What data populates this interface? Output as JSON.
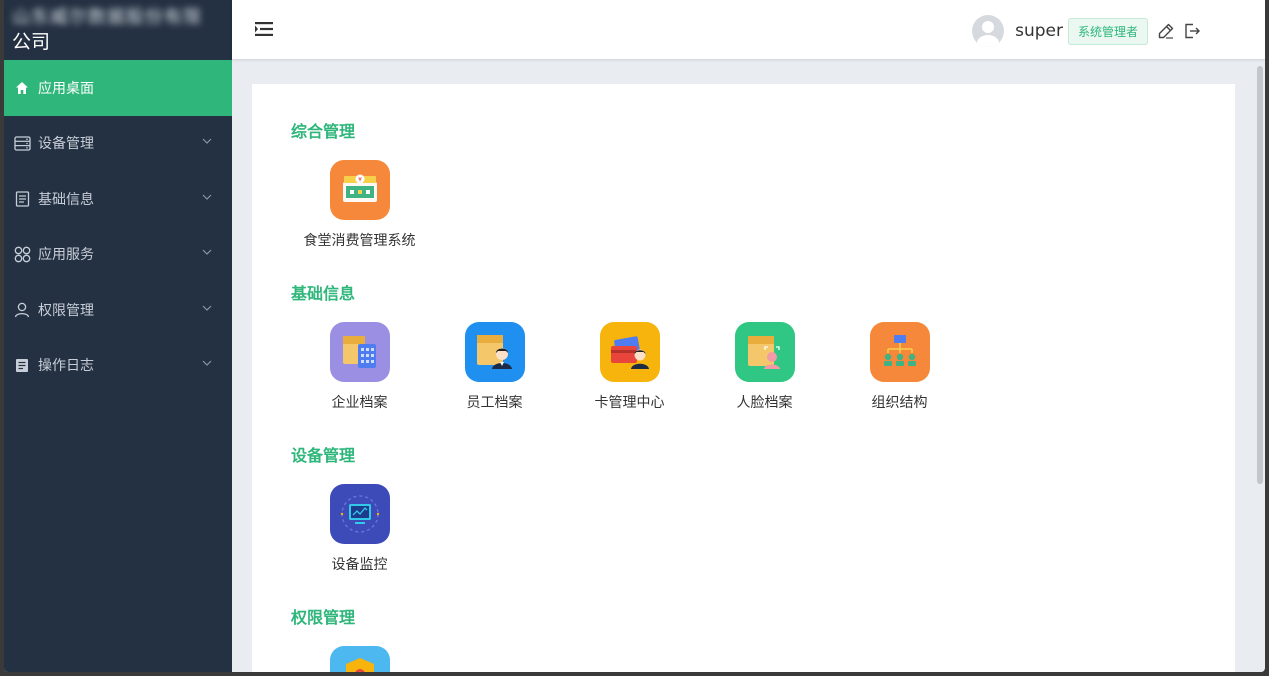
{
  "sidebar": {
    "brand_line1": "山东威尔数据股份有限",
    "brand_line2": "公司",
    "items": [
      {
        "label": "应用桌面",
        "icon": "home-icon"
      },
      {
        "label": "设备管理",
        "icon": "server-icon"
      },
      {
        "label": "基础信息",
        "icon": "document-icon"
      },
      {
        "label": "应用服务",
        "icon": "grid-icon"
      },
      {
        "label": "权限管理",
        "icon": "user-icon"
      },
      {
        "label": "操作日志",
        "icon": "notebook-icon"
      }
    ]
  },
  "header": {
    "username": "super",
    "role": "系统管理者"
  },
  "sections": [
    {
      "title": "综合管理",
      "apps": [
        {
          "label": "食堂消费管理系统",
          "icon": "canteen-icon",
          "color": "#f5883a"
        }
      ]
    },
    {
      "title": "基础信息",
      "apps": [
        {
          "label": "企业档案",
          "icon": "enterprise-file-icon",
          "color": "#9b8fe4"
        },
        {
          "label": "员工档案",
          "icon": "employee-file-icon",
          "color": "#1f8ff0"
        },
        {
          "label": "卡管理中心",
          "icon": "card-center-icon",
          "color": "#f6b40c"
        },
        {
          "label": "人脸档案",
          "icon": "face-file-icon",
          "color": "#2fc783"
        },
        {
          "label": "组织结构",
          "icon": "org-structure-icon",
          "color": "#f5883a"
        }
      ]
    },
    {
      "title": "设备管理",
      "apps": [
        {
          "label": "设备监控",
          "icon": "device-monitor-icon",
          "color": "#3d4bb8"
        }
      ]
    },
    {
      "title": "权限管理",
      "apps": [
        {
          "label": "",
          "icon": "permission-icon",
          "color": "#4db7f0"
        }
      ]
    }
  ],
  "colors": {
    "accent": "#2fb67b",
    "sidebar_bg": "#243142"
  }
}
